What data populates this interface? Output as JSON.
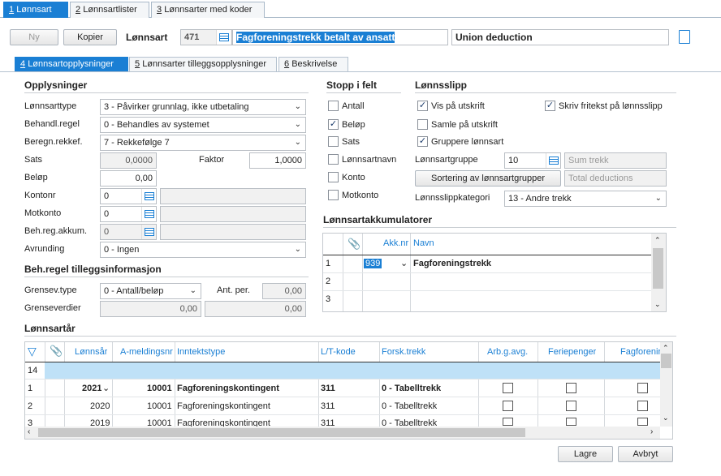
{
  "top_tabs": [
    {
      "key": "1",
      "label": "Lønnsart"
    },
    {
      "key": "2",
      "label": "Lønnsartlister"
    },
    {
      "key": "3",
      "label": "Lønnsarter med koder"
    }
  ],
  "toolbar": {
    "new_label": "Ny",
    "copy_label": "Kopier",
    "field_label": "Lønnsart",
    "code": "471",
    "name": "Fagforeningstrekk betalt av ansatt",
    "english_name": "Union deduction"
  },
  "sub_tabs": [
    {
      "key": "4",
      "label": "Lønnsartopplysninger"
    },
    {
      "key": "5",
      "label": "Lønnsarter tilleggsopplysninger"
    },
    {
      "key": "6",
      "label": "Beskrivelse"
    }
  ],
  "opplysninger": {
    "header": "Opplysninger",
    "lonnsarttype_label": "Lønnsarttype",
    "lonnsarttype_value": "3 - Påvirker grunnlag, ikke utbetaling",
    "behandl_label": "Behandl.regel",
    "behandl_value": "0 - Behandles av systemet",
    "beregn_label": "Beregn.rekkef.",
    "beregn_value": "7 - Rekkefølge 7",
    "sats_label": "Sats",
    "sats_value": "0,0000",
    "faktor_label": "Faktor",
    "faktor_value": "1,0000",
    "belop_label": "Beløp",
    "belop_value": "0,00",
    "kontonr_label": "Kontonr",
    "kontonr_value": "0",
    "motkonto_label": "Motkonto",
    "motkonto_value": "0",
    "behreg_label": "Beh.reg.akkum.",
    "behreg_value": "0",
    "avrunding_label": "Avrunding",
    "avrunding_value": "0 - Ingen"
  },
  "tillegg": {
    "header": "Beh.regel tilleggsinformasjon",
    "grensev_type_label": "Grensev.type",
    "grensev_type_value": "0 - Antall/beløp",
    "ant_per_label": "Ant. per.",
    "ant_per_value": "0,00",
    "grenseverdier_label": "Grenseverdier",
    "grenseverdier_1": "0,00",
    "grenseverdier_2": "0,00"
  },
  "stopp": {
    "header": "Stopp i felt",
    "items": [
      {
        "label": "Antall",
        "checked": false
      },
      {
        "label": "Beløp",
        "checked": true
      },
      {
        "label": "Sats",
        "checked": false
      },
      {
        "label": "Lønnsartnavn",
        "checked": false
      },
      {
        "label": "Konto",
        "checked": false
      },
      {
        "label": "Motkonto",
        "checked": false
      }
    ]
  },
  "lonnsslipp": {
    "header": "Lønnsslipp",
    "vis_label": "Vis på utskrift",
    "vis_checked": true,
    "skriv_label": "Skriv fritekst på lønnsslipp",
    "skriv_checked": true,
    "samle_label": "Samle på utskrift",
    "samle_checked": false,
    "gruppere_label": "Gruppere lønnsart",
    "gruppere_checked": true,
    "gruppe_label": "Lønnsartgruppe",
    "gruppe_value": "10",
    "gruppe_text": "Sum trekk",
    "sortering_label": "Sortering av lønnsartgrupper",
    "sortering_text": "Total deductions",
    "kategori_label": "Lønnsslippkategori",
    "kategori_value": "13 - Andre trekk"
  },
  "akkumulatorer": {
    "header": "Lønnsartakkumulatorer",
    "col_akknr": "Akk.nr",
    "col_navn": "Navn",
    "rows": [
      {
        "num": "1",
        "akknr": "939",
        "navn": "Fagforeningstrekk"
      },
      {
        "num": "2",
        "akknr": "",
        "navn": ""
      },
      {
        "num": "3",
        "akknr": "",
        "navn": ""
      }
    ]
  },
  "lonnsar": {
    "header": "Lønnsartår",
    "columns": [
      "Lønnsår",
      "A-meldingsnr",
      "Inntektstype",
      "L/T-kode",
      "Forsk.trekk",
      "Arb.g.avg.",
      "Feriepenger",
      "Fagforenin"
    ],
    "count_row": "14",
    "rows": [
      {
        "num": "1",
        "year": "2021",
        "ameld": "10001",
        "inntekt": "Fagforeningskontingent",
        "lt": "311",
        "forsk": "0 - Tabelltrekk"
      },
      {
        "num": "2",
        "year": "2020",
        "ameld": "10001",
        "inntekt": "Fagforeningskontingent",
        "lt": "311",
        "forsk": "0 - Tabelltrekk"
      },
      {
        "num": "3",
        "year": "2019",
        "ameld": "10001",
        "inntekt": "Fagforeningskontingent",
        "lt": "311",
        "forsk": "0 - Tabelltrekk"
      }
    ]
  },
  "footer": {
    "save_label": "Lagre",
    "cancel_label": "Avbryt"
  }
}
